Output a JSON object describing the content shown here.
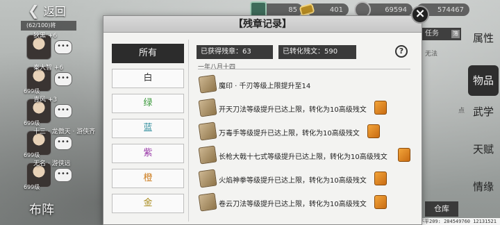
{
  "top_bar": {
    "back_label": "返回",
    "resources": [
      {
        "icon": "jade-icon",
        "value": "85"
      },
      {
        "icon": "gold-ingot-icon",
        "value": "401"
      },
      {
        "icon": "silver-icon",
        "value": "69594"
      },
      {
        "icon": "coin-icon",
        "value": "574467"
      }
    ]
  },
  "team": {
    "header": "(62/100)将",
    "characters": [
      {
        "name": "狄黑 +6",
        "level": "",
        "portrait": "female-portrait"
      },
      {
        "name": "秦大智 +6",
        "level": "699级",
        "portrait": "bald-portrait"
      },
      {
        "name": "青风 +3",
        "level": "699级",
        "portrait": "male-portrait"
      },
      {
        "name": "十三 · 龙傲天 · 游侠齐",
        "level": "699级",
        "portrait": "female-portrait"
      },
      {
        "name": "无名 · 游侠远",
        "level": "699级",
        "portrait": "female-portrait"
      },
      {
        "name": "",
        "level": "699级",
        "portrait": "female-portrait"
      }
    ],
    "lineup_label": "布阵"
  },
  "side_menu": {
    "items": [
      "属性",
      "物品",
      "武学",
      "天赋",
      "情缘"
    ],
    "active_index": 1
  },
  "background": {
    "task_tab": "任务",
    "task_tab_icon": "簿",
    "right_texts": [
      "无法",
      "点"
    ],
    "bottom_buttons": [
      "仓库"
    ],
    "debug_text": "跨服不平209: 284549760 12131521"
  },
  "modal": {
    "title": "【残章记录】",
    "close_icon": "×",
    "filters": [
      "所有",
      "白",
      "绿",
      "蓝",
      "紫",
      "橙",
      "金"
    ],
    "filter_colors": [
      "#f2f2f2",
      "#333333",
      "#3d9a3d",
      "#2a8a9a",
      "#9a3aa8",
      "#cc7a1a",
      "#a88a1a"
    ],
    "active_filter": 0,
    "stats": {
      "obtained": "已获得残章：63",
      "converted": "已转化残文：590"
    },
    "help_icon": "?",
    "date": "一年八月十四",
    "records": [
      {
        "text": "魔印 · 千刃等级上限提升至14",
        "converted": false
      },
      {
        "text": "开天刀法等级提升已达上限，转化为10高级残文",
        "converted": true
      },
      {
        "text": "万毒手等级提升已达上限，转化为10高级残文",
        "converted": true
      },
      {
        "text": "长枪大戟十七式等级提升已达上限，转化为10高级残文",
        "converted": true
      },
      {
        "text": "火焰神拳等级提升已达上限，转化为10高级残文",
        "converted": true
      },
      {
        "text": "卷云刀法等级提升已达上限，转化为10高级残文",
        "converted": true
      }
    ]
  }
}
